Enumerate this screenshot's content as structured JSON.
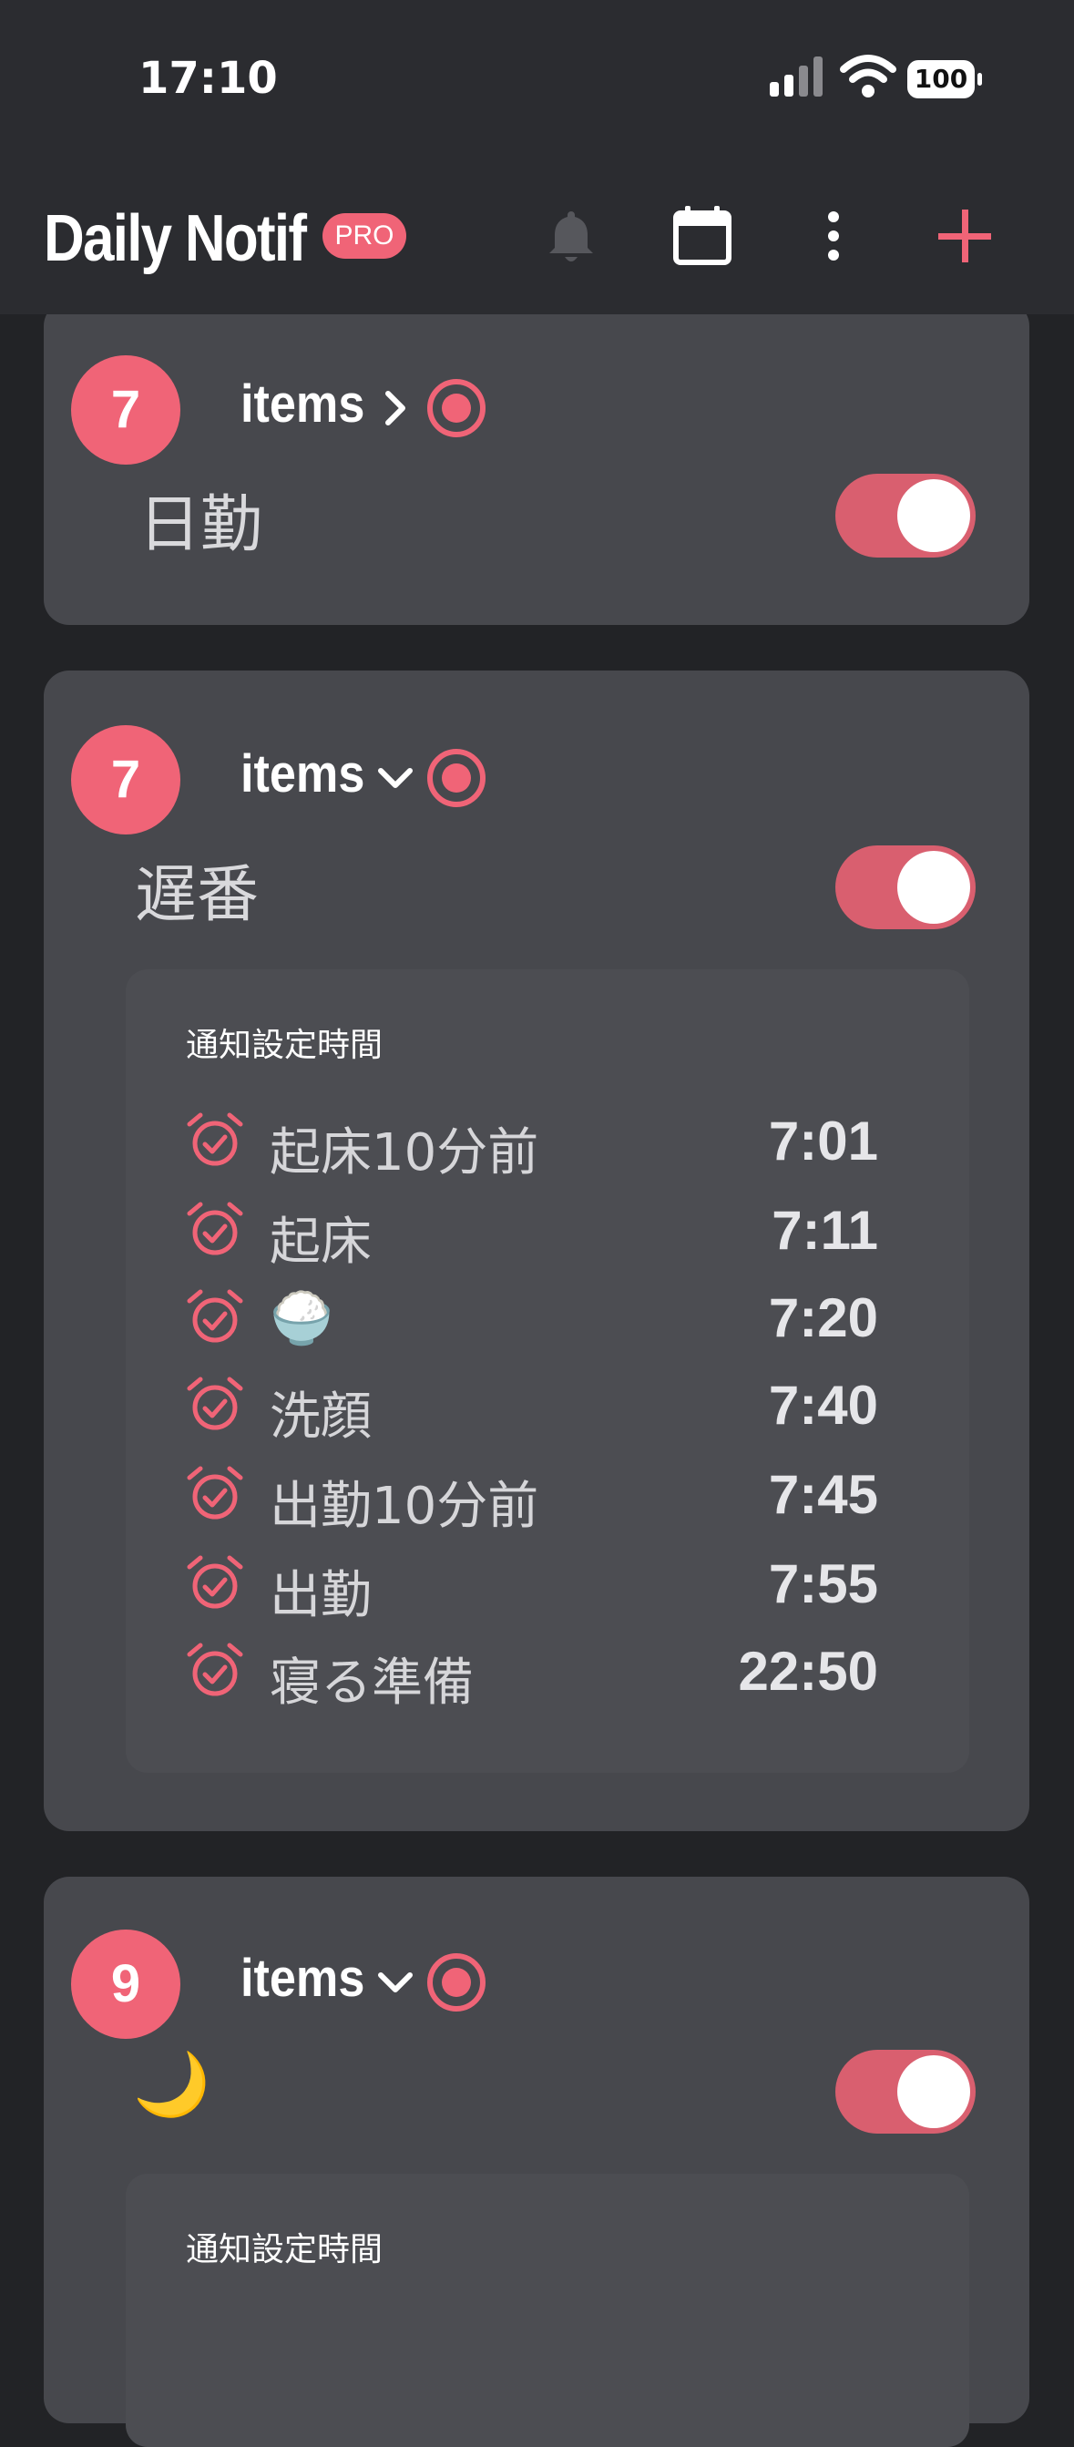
{
  "status_bar": {
    "time": "17:10",
    "battery": "100"
  },
  "header": {
    "title": "Daily Notif",
    "badge": "PRO",
    "icons": [
      "bell-icon",
      "calendar-icon",
      "more-vertical-icon",
      "plus-icon"
    ]
  },
  "colors": {
    "accent": "#f06477",
    "card": "#47484d",
    "background": "#222326"
  },
  "cards": [
    {
      "count": "7",
      "items_label": "items",
      "name": "日勤",
      "expanded": false,
      "enabled": true
    },
    {
      "count": "7",
      "items_label": "items",
      "name": "遅番",
      "expanded": true,
      "enabled": true,
      "section_heading": "通知設定時間",
      "rows": [
        {
          "label": "起床10分前",
          "time": "7:01"
        },
        {
          "label": "起床",
          "time": "7:11"
        },
        {
          "label": "🍚",
          "time": "7:20"
        },
        {
          "label": "洗顔",
          "time": "7:40"
        },
        {
          "label": "出勤10分前",
          "time": "7:45"
        },
        {
          "label": "出勤",
          "time": "7:55"
        },
        {
          "label": "寝る準備",
          "time": "22:50"
        }
      ]
    },
    {
      "count": "9",
      "items_label": "items",
      "name": "🌙",
      "expanded": true,
      "enabled": true,
      "section_heading": "通知設定時間"
    }
  ]
}
